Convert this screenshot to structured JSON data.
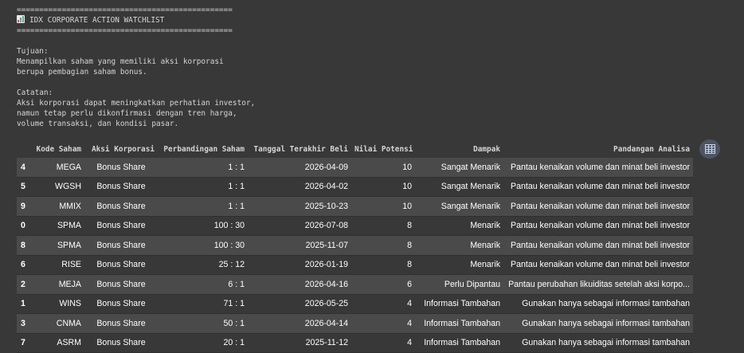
{
  "output": {
    "separator": "================================================",
    "title": "IDX CORPORATE ACTION WATCHLIST",
    "title_icon": "bar-chart-emoji-icon",
    "tujuan_label": "Tujuan:",
    "tujuan_lines": [
      "Menampilkan saham yang memiliki aksi korporasi",
      "berupa pembagian saham bonus."
    ],
    "catatan_label": "Catatan:",
    "catatan_lines": [
      "Aksi korporasi dapat meningkatkan perhatian investor,",
      "namun tetap perlu dikonfirmasi dengan tren harga,",
      "volume transaksi, dan kondisi pasar."
    ]
  },
  "table": {
    "headers": [
      "",
      "Kode Saham",
      "Aksi Korporasi",
      "Perbandingan Saham",
      "Tanggal Terakhir Beli",
      "Nilai Potensi",
      "Dampak",
      "Pandangan Analisa"
    ],
    "rows": [
      [
        "4",
        "MEGA",
        "Bonus Share",
        "1 : 1",
        "2026-04-09",
        "10",
        "Sangat Menarik",
        "Pantau kenaikan volume dan minat beli investor"
      ],
      [
        "5",
        "WGSH",
        "Bonus Share",
        "1 : 1",
        "2026-04-02",
        "10",
        "Sangat Menarik",
        "Pantau kenaikan volume dan minat beli investor"
      ],
      [
        "9",
        "MMIX",
        "Bonus Share",
        "1 : 1",
        "2025-10-23",
        "10",
        "Sangat Menarik",
        "Pantau kenaikan volume dan minat beli investor"
      ],
      [
        "0",
        "SPMA",
        "Bonus Share",
        "100 : 30",
        "2026-07-08",
        "8",
        "Menarik",
        "Pantau kenaikan volume dan minat beli investor"
      ],
      [
        "8",
        "SPMA",
        "Bonus Share",
        "100 : 30",
        "2025-11-07",
        "8",
        "Menarik",
        "Pantau kenaikan volume dan minat beli investor"
      ],
      [
        "6",
        "RISE",
        "Bonus Share",
        "25 : 12",
        "2026-01-19",
        "8",
        "Menarik",
        "Pantau kenaikan volume dan minat beli investor"
      ],
      [
        "2",
        "MEJA",
        "Bonus Share",
        "6 : 1",
        "2026-04-16",
        "6",
        "Perlu Dipantau",
        "Pantau perubahan likuiditas setelah aksi korpo..."
      ],
      [
        "1",
        "WINS",
        "Bonus Share",
        "71 : 1",
        "2026-05-25",
        "4",
        "Informasi Tambahan",
        "Gunakan hanya sebagai informasi tambahan"
      ],
      [
        "3",
        "CNMA",
        "Bonus Share",
        "50 : 1",
        "2026-04-14",
        "4",
        "Informasi Tambahan",
        "Gunakan hanya sebagai informasi tambahan"
      ],
      [
        "7",
        "ASRM",
        "Bonus Share",
        "20 : 1",
        "2025-11-12",
        "4",
        "Informasi Tambahan",
        "Gunakan hanya sebagai informasi tambahan"
      ]
    ]
  },
  "toolbar": {
    "table_icon": "table-view-icon"
  }
}
